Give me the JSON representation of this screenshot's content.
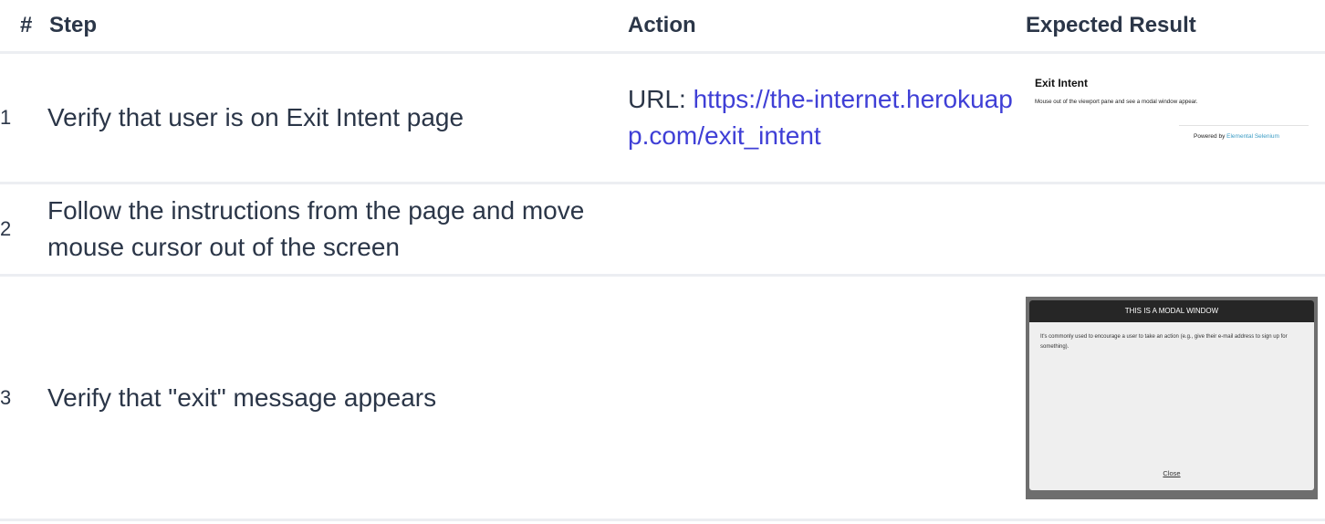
{
  "headers": {
    "num": "#",
    "step": "Step",
    "action": "Action",
    "expected": "Expected Result"
  },
  "rows": [
    {
      "num": "1",
      "step": "Verify that user is on Exit Intent page",
      "action_prefix": "URL: ",
      "action_link": "https://the-internet.herokuapp.com/exit_intent"
    },
    {
      "num": "2",
      "step": "Follow the instructions from the page and move mouse cursor out of the screen"
    },
    {
      "num": "3",
      "step": "Verify that \"exit\" message appears"
    }
  ],
  "expected_1": {
    "title": "Exit Intent",
    "description": "Mouse out of the viewport pane and see a modal window appear.",
    "powered_by": "Powered by ",
    "powered_link": "Elemental Selenium"
  },
  "expected_3": {
    "modal_title": "THIS IS A MODAL WINDOW",
    "modal_body": "It's commonly used to encourage a user to take an action (e.g., give their e-mail address to sign up for something).",
    "close": "Close"
  },
  "colors": {
    "text": "#2b3648",
    "link": "#3f3fd6",
    "divider": "#eceef2",
    "modal_header": "#262626",
    "modal_overlay": "#6e6e6e"
  }
}
